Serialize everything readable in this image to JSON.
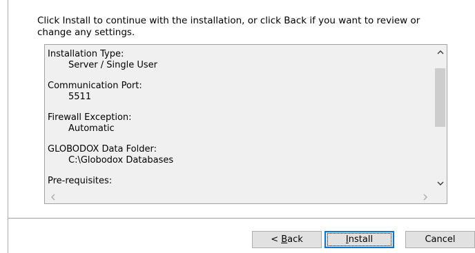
{
  "intro_text": "Click Install to continue with the installation, or click Back if you want to review or change any settings.",
  "summary": [
    {
      "label": "Installation Type:",
      "value": "Server / Single User"
    },
    {
      "label": "Communication Port:",
      "value": "5511"
    },
    {
      "label": "Firewall Exception:",
      "value": "Automatic"
    },
    {
      "label": "GLOBODOX Data Folder:",
      "value": "C:\\Globodox Databases"
    },
    {
      "label": "Pre-requisites:",
      "value": ""
    }
  ],
  "buttons": {
    "back_prefix": "< ",
    "back_mnemonic": "B",
    "back_rest": "ack",
    "install_mnemonic": "I",
    "install_rest": "nstall",
    "cancel": "Cancel"
  },
  "icons": {
    "scroll_up": "chevron-up-icon",
    "scroll_down": "chevron-down-icon",
    "scroll_left": "chevron-left-icon",
    "scroll_right": "chevron-right-icon"
  }
}
